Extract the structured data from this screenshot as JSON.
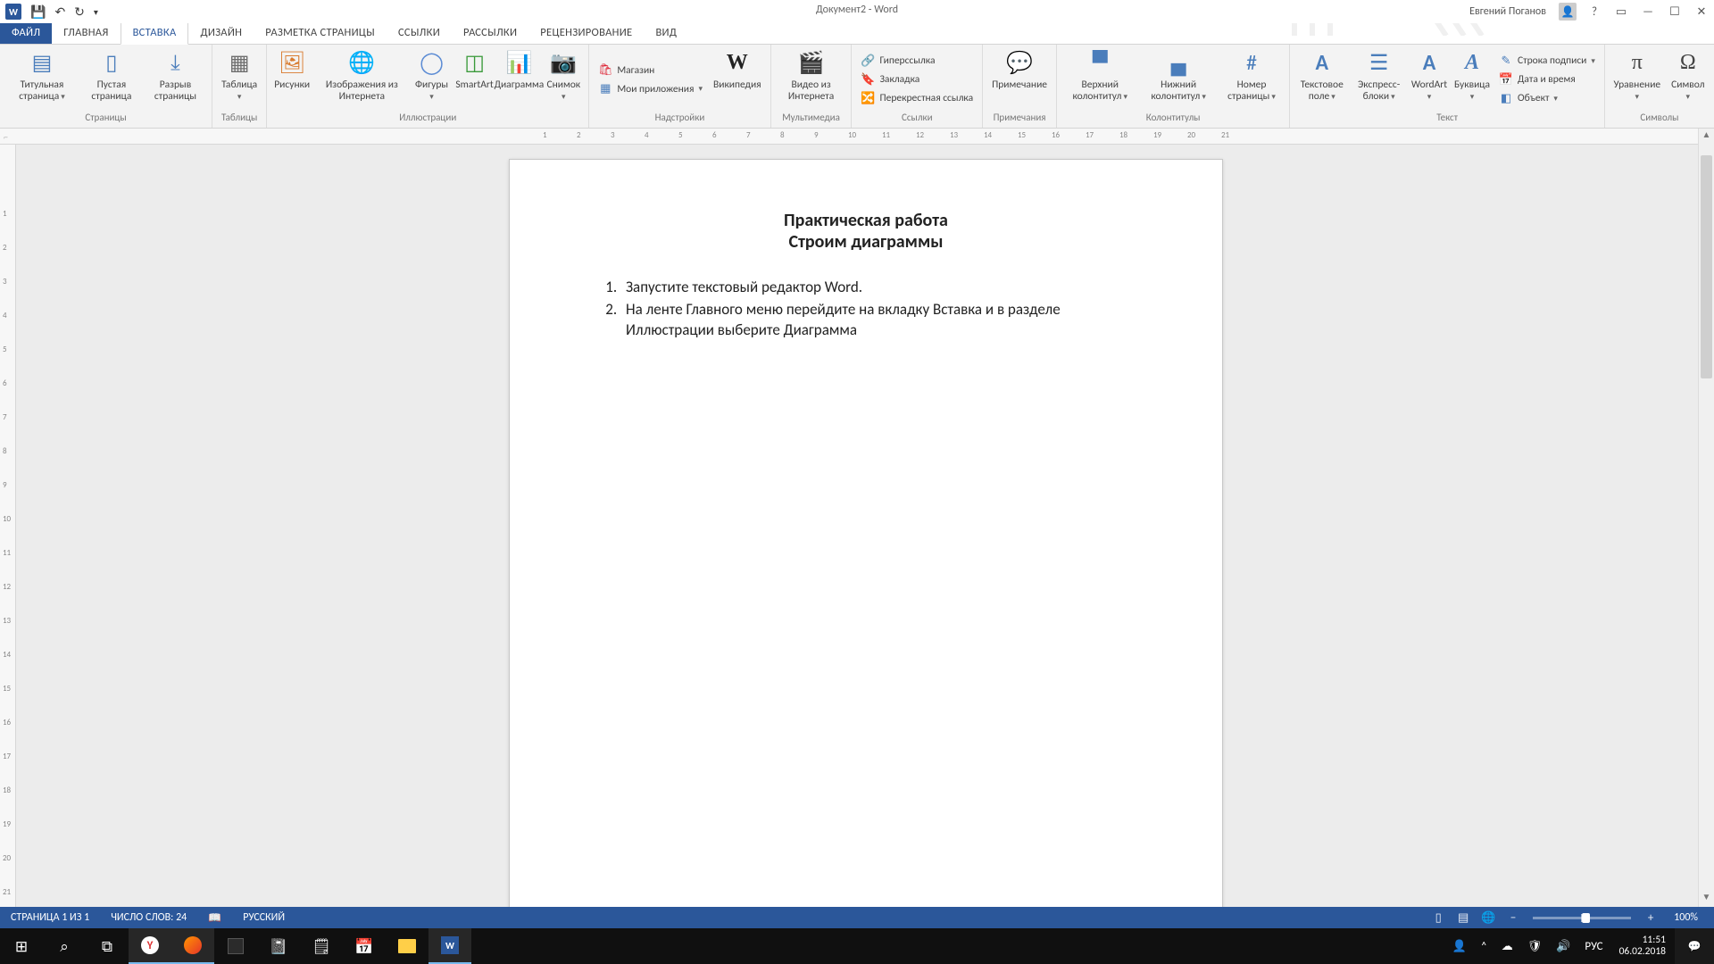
{
  "title": "Документ2 - Word",
  "user": "Евгений Поганов",
  "qat": {
    "save": "save-icon",
    "undo": "undo-icon",
    "redo": "redo-icon",
    "touch": "touch-icon"
  },
  "tabs": {
    "file": "ФАЙЛ",
    "home": "ГЛАВНАЯ",
    "insert": "ВСТАВКА",
    "design": "ДИЗАЙН",
    "layout": "РАЗМЕТКА СТРАНИЦЫ",
    "refs": "ССЫЛКИ",
    "mail": "РАССЫЛКИ",
    "review": "РЕЦЕНЗИРОВАНИЕ",
    "view": "ВИД"
  },
  "ribbon": {
    "pages": {
      "label": "Страницы",
      "cover": "Титульная страница",
      "blank": "Пустая страница",
      "break": "Разрыв страницы"
    },
    "tables": {
      "label": "Таблицы",
      "table": "Таблица"
    },
    "illus": {
      "label": "Иллюстрации",
      "pics": "Рисунки",
      "online": "Изображения из Интернета",
      "shapes": "Фигуры",
      "smart": "SmartArt",
      "chart": "Диаграмма",
      "shot": "Снимок"
    },
    "addins": {
      "label": "Надстройки",
      "store": "Магазин",
      "myapps": "Мои приложения",
      "wiki": "Википедия"
    },
    "media": {
      "label": "Мультимедиа",
      "video": "Видео из Интернета"
    },
    "links": {
      "label": "Ссылки",
      "hyper": "Гиперссылка",
      "bookmark": "Закладка",
      "xref": "Перекрестная ссылка"
    },
    "comments": {
      "label": "Примечания",
      "comment": "Примечание"
    },
    "hf": {
      "label": "Колонтитулы",
      "header": "Верхний колонтитул",
      "footer": "Нижний колонтитул",
      "pgnum": "Номер страницы"
    },
    "text": {
      "label": "Текст",
      "box": "Текстовое поле",
      "quick": "Экспресс-блоки",
      "wordart": "WordArt",
      "dropcap": "Буквица",
      "sig": "Строка подписи",
      "date": "Дата и время",
      "obj": "Объект"
    },
    "symbols": {
      "label": "Символы",
      "eq": "Уравнение",
      "sym": "Символ"
    }
  },
  "doc": {
    "h1": "Практическая работа",
    "h2": "Строим диаграммы",
    "li1": "Запустите текстовый редактор Word.",
    "li2": "На ленте Главного меню перейдите на вкладку Вставка и в разделе Иллюстрации выберите Диаграмма"
  },
  "status": {
    "page": "СТРАНИЦА 1 ИЗ 1",
    "words": "ЧИСЛО СЛОВ: 24",
    "lang": "РУССКИЙ",
    "zoom": "100%"
  },
  "taskbar": {
    "lang": "РУС",
    "time": "11:51",
    "date": "06.02.2018"
  }
}
